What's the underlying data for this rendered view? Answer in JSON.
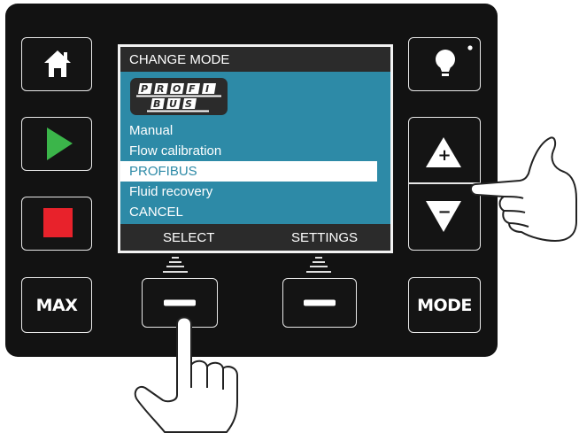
{
  "screen": {
    "title": "CHANGE MODE",
    "logo_text": [
      "PROFI",
      "BUS"
    ],
    "menu": [
      {
        "label": "Manual",
        "selected": false
      },
      {
        "label": "Flow calibration",
        "selected": false
      },
      {
        "label": "PROFIBUS",
        "selected": true
      },
      {
        "label": "Fluid recovery",
        "selected": false
      },
      {
        "label": "CANCEL",
        "selected": false
      }
    ],
    "softkeys": {
      "left": "SELECT",
      "right": "SETTINGS"
    }
  },
  "keys": {
    "max_label": "MAX",
    "mode_label": "MODE",
    "plus": "+",
    "minus": "−"
  },
  "colors": {
    "panel": "#121212",
    "screen_body": "#2d8aa7",
    "play": "#3bb54a",
    "stop": "#e8222b"
  },
  "icons": [
    "home-icon",
    "play-icon",
    "stop-icon",
    "lightbulb-icon",
    "plus-icon",
    "minus-icon",
    "pointing-hand-icon"
  ]
}
